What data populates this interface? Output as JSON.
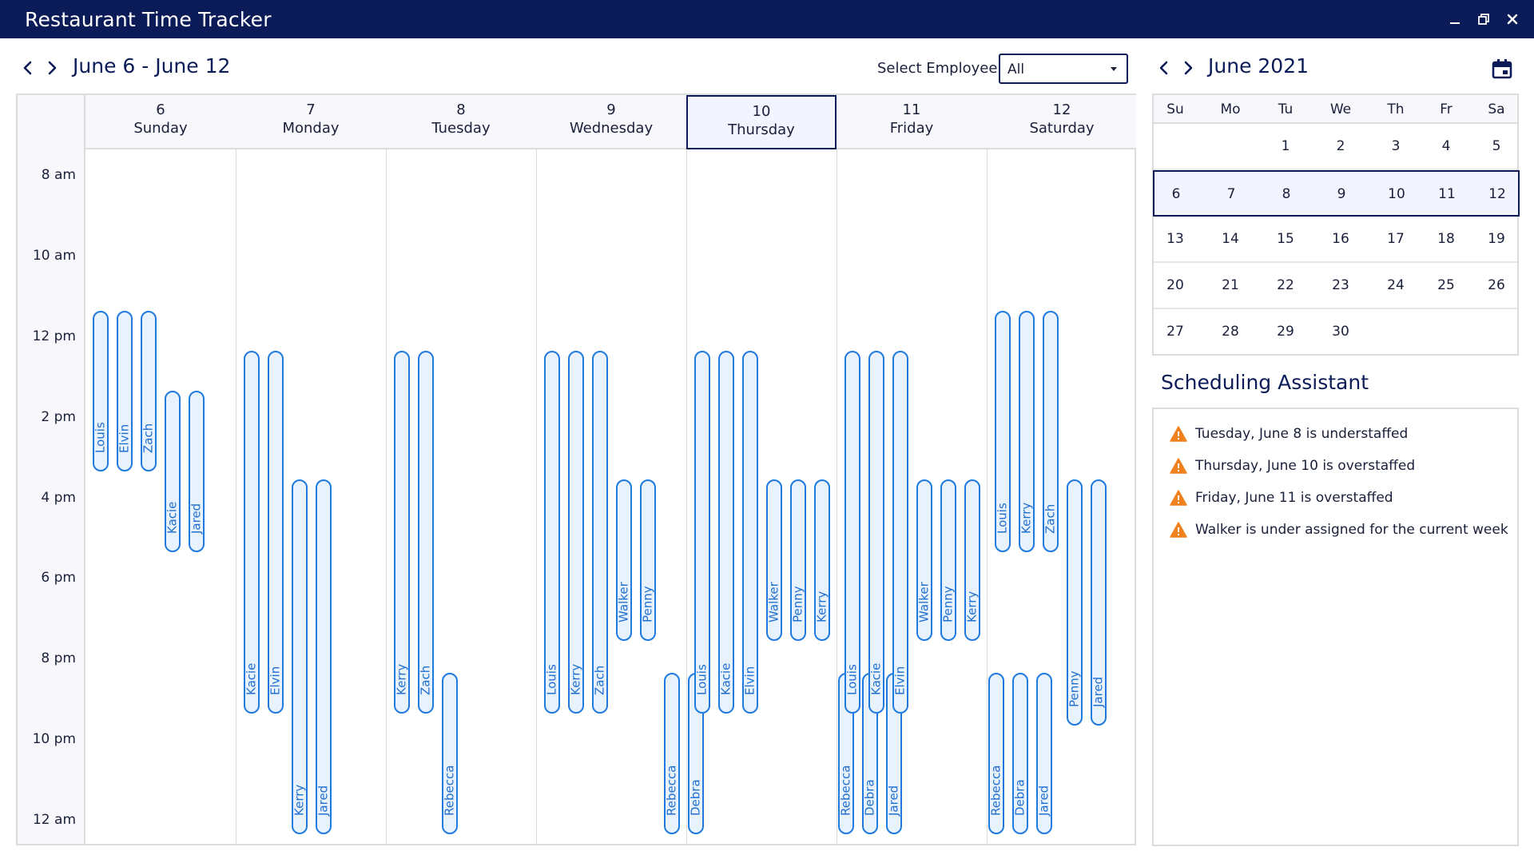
{
  "app": {
    "title": "Restaurant Time Tracker"
  },
  "week": {
    "range": "June 6 - June 12"
  },
  "employee_filter": {
    "label": "Select Employee:",
    "value": "All"
  },
  "time_labels": [
    "8 am",
    "10 am",
    "12 pm",
    "2 pm",
    "4 pm",
    "6 pm",
    "8 pm",
    "10 pm",
    "12 am"
  ],
  "days": [
    {
      "num": "6",
      "name": "Sunday",
      "selected": false,
      "shifts": [
        {
          "employee": "Louis",
          "start": 11,
          "end": 15
        },
        {
          "employee": "Elvin",
          "start": 11,
          "end": 15
        },
        {
          "employee": "Zach",
          "start": 11,
          "end": 15
        },
        {
          "employee": "Kacie",
          "start": 13,
          "end": 17
        },
        {
          "employee": "Jared",
          "start": 13,
          "end": 17
        }
      ]
    },
    {
      "num": "7",
      "name": "Monday",
      "selected": false,
      "shifts": [
        {
          "employee": "Kacie",
          "start": 12,
          "end": 21
        },
        {
          "employee": "Elvin",
          "start": 12,
          "end": 21
        },
        {
          "employee": "Kerry",
          "start": 15.2,
          "end": 24
        },
        {
          "employee": "Jared",
          "start": 15.2,
          "end": 24
        }
      ]
    },
    {
      "num": "8",
      "name": "Tuesday",
      "selected": false,
      "shifts": [
        {
          "employee": "Kerry",
          "start": 12,
          "end": 21
        },
        {
          "employee": "Zach",
          "start": 12,
          "end": 21
        },
        {
          "employee": "Rebecca",
          "start": 20,
          "end": 24
        }
      ]
    },
    {
      "num": "9",
      "name": "Wednesday",
      "selected": false,
      "shifts": [
        {
          "employee": "Louis",
          "start": 12,
          "end": 21
        },
        {
          "employee": "Kerry",
          "start": 12,
          "end": 21
        },
        {
          "employee": "Zach",
          "start": 12,
          "end": 21
        },
        {
          "employee": "Walker",
          "start": 15.2,
          "end": 19.2
        },
        {
          "employee": "Penny",
          "start": 15.2,
          "end": 19.2
        },
        {
          "employee": "Rebecca",
          "start": 20,
          "end": 24
        },
        {
          "employee": "Debra",
          "start": 20,
          "end": 24
        }
      ]
    },
    {
      "num": "10",
      "name": "Thursday",
      "selected": true,
      "shifts": [
        {
          "employee": "Louis",
          "start": 12,
          "end": 21
        },
        {
          "employee": "Kacie",
          "start": 12,
          "end": 21
        },
        {
          "employee": "Elvin",
          "start": 12,
          "end": 21
        },
        {
          "employee": "Walker",
          "start": 15.2,
          "end": 19.2
        },
        {
          "employee": "Penny",
          "start": 15.2,
          "end": 19.2
        },
        {
          "employee": "Kerry",
          "start": 15.2,
          "end": 19.2
        },
        {
          "employee": "Rebecca",
          "start": 20,
          "end": 24
        },
        {
          "employee": "Debra",
          "start": 20,
          "end": 24
        },
        {
          "employee": "Jared",
          "start": 20,
          "end": 24
        }
      ]
    },
    {
      "num": "11",
      "name": "Friday",
      "selected": false,
      "shifts": [
        {
          "employee": "Louis",
          "start": 12,
          "end": 21
        },
        {
          "employee": "Kacie",
          "start": 12,
          "end": 21
        },
        {
          "employee": "Elvin",
          "start": 12,
          "end": 21
        },
        {
          "employee": "Walker",
          "start": 15.2,
          "end": 19.2
        },
        {
          "employee": "Penny",
          "start": 15.2,
          "end": 19.2
        },
        {
          "employee": "Kerry",
          "start": 15.2,
          "end": 19.2
        },
        {
          "employee": "Rebecca",
          "start": 20,
          "end": 24
        },
        {
          "employee": "Debra",
          "start": 20,
          "end": 24
        },
        {
          "employee": "Jared",
          "start": 20,
          "end": 24
        }
      ]
    },
    {
      "num": "12",
      "name": "Saturday",
      "selected": false,
      "shifts": [
        {
          "employee": "Louis",
          "start": 11,
          "end": 17
        },
        {
          "employee": "Kerry",
          "start": 11,
          "end": 17
        },
        {
          "employee": "Zach",
          "start": 11,
          "end": 17
        },
        {
          "employee": "Penny",
          "start": 15.2,
          "end": 21.3
        },
        {
          "employee": "Jared",
          "start": 15.2,
          "end": 21.3
        }
      ]
    }
  ],
  "mini_calendar": {
    "title": "June 2021",
    "weekdays": [
      "Su",
      "Mo",
      "Tu",
      "We",
      "Th",
      "Fr",
      "Sa"
    ],
    "weeks": [
      [
        "",
        "",
        "1",
        "2",
        "3",
        "4",
        "5"
      ],
      [
        "6",
        "7",
        "8",
        "9",
        "10",
        "11",
        "12"
      ],
      [
        "13",
        "14",
        "15",
        "16",
        "17",
        "18",
        "19"
      ],
      [
        "20",
        "21",
        "22",
        "23",
        "24",
        "25",
        "26"
      ],
      [
        "27",
        "28",
        "29",
        "30",
        "",
        "",
        ""
      ]
    ],
    "selected_week": 1
  },
  "assistant": {
    "title": "Scheduling Assistant",
    "alerts": [
      "Tuesday, June 8 is understaffed",
      "Thursday, June 10 is overstaffed",
      "Friday, June 11 is overstaffed",
      "Walker is under assigned for the current week"
    ]
  },
  "colors": {
    "titlebar": "#0b1b57",
    "shift_border": "#1f7ae0",
    "shift_fill": "#e8f2fc",
    "warning": "#f0821e"
  },
  "icons": {
    "window_controls": [
      "minimize-icon",
      "restore-icon",
      "close-icon"
    ],
    "week_nav": [
      "chevron-left-icon",
      "chevron-right-icon"
    ],
    "calendar": "calendar-icon",
    "alert": "warning-icon"
  }
}
